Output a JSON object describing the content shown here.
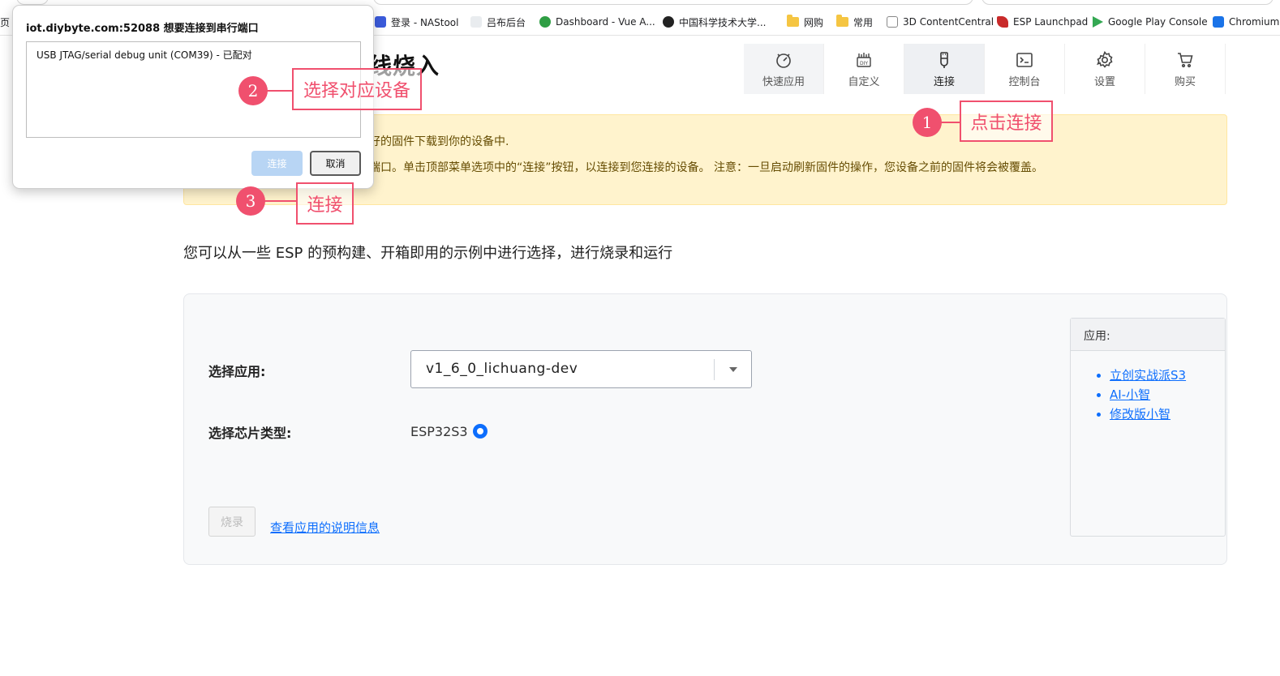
{
  "bookmarks": [
    {
      "label": "登录 - NAStool",
      "color": "#3b5bdb"
    },
    {
      "label": "吕布后台",
      "color": "#e9ecef"
    },
    {
      "label": "Dashboard - Vue A...",
      "color": "#2f9e44"
    },
    {
      "label": "中国科学技术大学...",
      "color": "#222222"
    },
    {
      "label": "网购",
      "color": "#f5c542"
    },
    {
      "label": "常用",
      "color": "#f5c542"
    },
    {
      "label": "3D ContentCentral",
      "color": "#888888"
    },
    {
      "label": "ESP Launchpad",
      "color": "#c92a2a"
    },
    {
      "label": "Google Play Console",
      "color": "#34a853"
    },
    {
      "label": "Chromium",
      "color": "#1a73e8"
    }
  ],
  "page": {
    "title_partial": "线烧入",
    "alert_line1": "好的固件下载到你的设备中.",
    "alert_line2": "端口。单击顶部菜单选项中的“连接”按钮，以连接到您连接的设备。 注意：一旦启动刷新固件的操作，您设备之前的固件将会被覆盖。",
    "intro": "您可以从一些 ESP 的预构建、开箱即用的示例中进行选择，进行烧录和运行"
  },
  "nav": [
    {
      "label": "快速应用",
      "icon": "quick-app-icon"
    },
    {
      "label": "自定义",
      "icon": "diy-icon"
    },
    {
      "label": "连接",
      "icon": "usb-plug-icon"
    },
    {
      "label": "控制台",
      "icon": "terminal-icon"
    },
    {
      "label": "设置",
      "icon": "gear-icon"
    },
    {
      "label": "购买",
      "icon": "cart-icon"
    }
  ],
  "form": {
    "app_label": "选择应用:",
    "app_value": "v1_6_0_lichuang-dev",
    "chip_label": "选择芯片类型:",
    "chip_value": "ESP32S3",
    "flash_button": "烧录",
    "info_link": "查看应用的说明信息"
  },
  "app_panel": {
    "header": "应用:",
    "items": [
      "立创实战派S3",
      "AI-小智",
      "修改版小智"
    ]
  },
  "dialog": {
    "title": "iot.diybyte.com:52088 想要连接到串行端口",
    "device": "USB JTAG/serial debug unit (COM39) - 已配对",
    "connect_button": "连接",
    "cancel_button": "取消"
  },
  "annotations": [
    {
      "number": "1",
      "text": "点击连接"
    },
    {
      "number": "2",
      "text": "选择对应设备"
    },
    {
      "number": "3",
      "text": "连接"
    }
  ],
  "colors": {
    "accent": "#0d6efd",
    "annotation": "#f0506e",
    "alert_bg": "#fff3cd"
  }
}
